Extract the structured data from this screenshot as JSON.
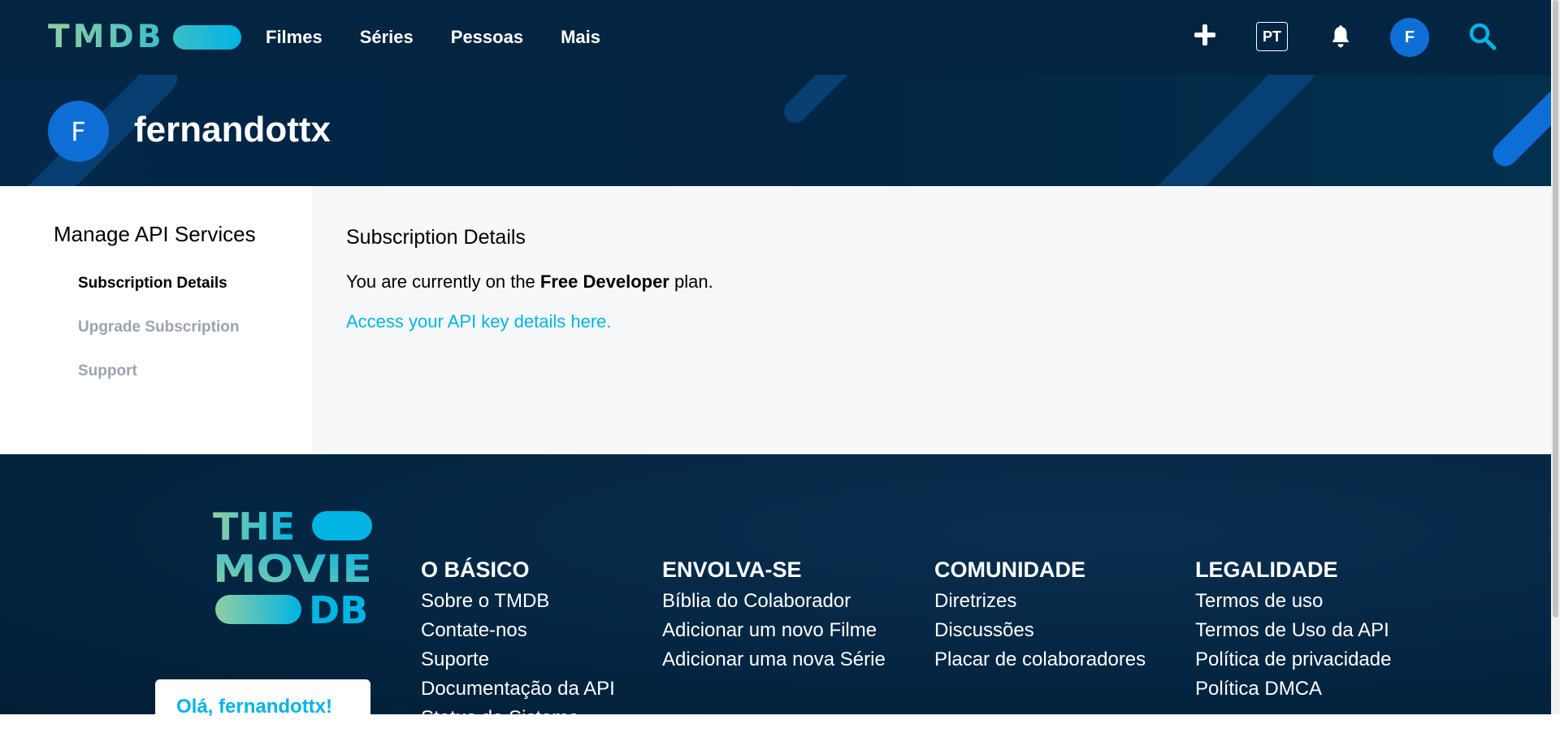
{
  "nav": {
    "logo_text": "TMDB",
    "menu": [
      "Filmes",
      "Séries",
      "Pessoas",
      "Mais"
    ],
    "language": "PT",
    "avatar_letter": "F"
  },
  "banner": {
    "avatar_letter": "F",
    "username": "fernandottx"
  },
  "sidebar": {
    "title": "Manage API Services",
    "items": [
      "Subscription Details",
      "Upgrade Subscription",
      "Support"
    ]
  },
  "main": {
    "heading": "Subscription Details",
    "plan_prefix": "You are currently on the ",
    "plan_name": "Free Developer",
    "plan_suffix": " plan.",
    "api_link": "Access your API key details here."
  },
  "footer": {
    "logo_lines": [
      "THE",
      "MOVIE",
      "DB"
    ],
    "greeting": "Olá, fernandottx!",
    "columns": [
      {
        "title": "O Básico",
        "links": [
          "Sobre o TMDB",
          "Contate-nos",
          "Suporte",
          "Documentação da API",
          "Status do Sistema"
        ]
      },
      {
        "title": "Envolva-se",
        "links": [
          "Bíblia do Colaborador",
          "Adicionar um novo Filme",
          "Adicionar uma nova Série"
        ]
      },
      {
        "title": "Comunidade",
        "links": [
          "Diretrizes",
          "Discussões",
          "Placar de colaboradores"
        ]
      },
      {
        "title": "Legalidade",
        "links": [
          "Termos de uso",
          "Termos de Uso da API",
          "Política de privacidade",
          "Política DMCA"
        ]
      }
    ]
  },
  "colors": {
    "nav_bg": "#032541",
    "accent_blue": "#01b4e4",
    "accent_green": "#90cea1",
    "avatar_bg": "#0d6fd6"
  }
}
